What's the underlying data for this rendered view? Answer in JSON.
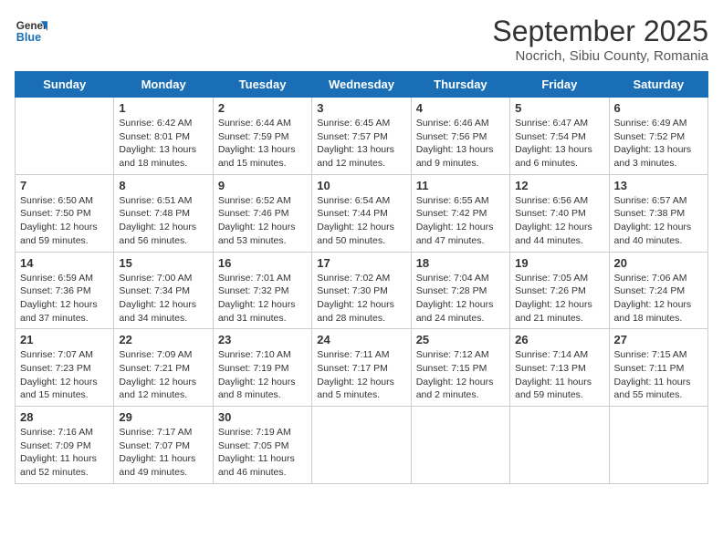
{
  "logo": {
    "line1": "General",
    "line2": "Blue"
  },
  "title": "September 2025",
  "subtitle": "Nocrich, Sibiu County, Romania",
  "days_of_week": [
    "Sunday",
    "Monday",
    "Tuesday",
    "Wednesday",
    "Thursday",
    "Friday",
    "Saturday"
  ],
  "weeks": [
    [
      {
        "day": "",
        "info": ""
      },
      {
        "day": "1",
        "info": "Sunrise: 6:42 AM\nSunset: 8:01 PM\nDaylight: 13 hours\nand 18 minutes."
      },
      {
        "day": "2",
        "info": "Sunrise: 6:44 AM\nSunset: 7:59 PM\nDaylight: 13 hours\nand 15 minutes."
      },
      {
        "day": "3",
        "info": "Sunrise: 6:45 AM\nSunset: 7:57 PM\nDaylight: 13 hours\nand 12 minutes."
      },
      {
        "day": "4",
        "info": "Sunrise: 6:46 AM\nSunset: 7:56 PM\nDaylight: 13 hours\nand 9 minutes."
      },
      {
        "day": "5",
        "info": "Sunrise: 6:47 AM\nSunset: 7:54 PM\nDaylight: 13 hours\nand 6 minutes."
      },
      {
        "day": "6",
        "info": "Sunrise: 6:49 AM\nSunset: 7:52 PM\nDaylight: 13 hours\nand 3 minutes."
      }
    ],
    [
      {
        "day": "7",
        "info": "Sunrise: 6:50 AM\nSunset: 7:50 PM\nDaylight: 12 hours\nand 59 minutes."
      },
      {
        "day": "8",
        "info": "Sunrise: 6:51 AM\nSunset: 7:48 PM\nDaylight: 12 hours\nand 56 minutes."
      },
      {
        "day": "9",
        "info": "Sunrise: 6:52 AM\nSunset: 7:46 PM\nDaylight: 12 hours\nand 53 minutes."
      },
      {
        "day": "10",
        "info": "Sunrise: 6:54 AM\nSunset: 7:44 PM\nDaylight: 12 hours\nand 50 minutes."
      },
      {
        "day": "11",
        "info": "Sunrise: 6:55 AM\nSunset: 7:42 PM\nDaylight: 12 hours\nand 47 minutes."
      },
      {
        "day": "12",
        "info": "Sunrise: 6:56 AM\nSunset: 7:40 PM\nDaylight: 12 hours\nand 44 minutes."
      },
      {
        "day": "13",
        "info": "Sunrise: 6:57 AM\nSunset: 7:38 PM\nDaylight: 12 hours\nand 40 minutes."
      }
    ],
    [
      {
        "day": "14",
        "info": "Sunrise: 6:59 AM\nSunset: 7:36 PM\nDaylight: 12 hours\nand 37 minutes."
      },
      {
        "day": "15",
        "info": "Sunrise: 7:00 AM\nSunset: 7:34 PM\nDaylight: 12 hours\nand 34 minutes."
      },
      {
        "day": "16",
        "info": "Sunrise: 7:01 AM\nSunset: 7:32 PM\nDaylight: 12 hours\nand 31 minutes."
      },
      {
        "day": "17",
        "info": "Sunrise: 7:02 AM\nSunset: 7:30 PM\nDaylight: 12 hours\nand 28 minutes."
      },
      {
        "day": "18",
        "info": "Sunrise: 7:04 AM\nSunset: 7:28 PM\nDaylight: 12 hours\nand 24 minutes."
      },
      {
        "day": "19",
        "info": "Sunrise: 7:05 AM\nSunset: 7:26 PM\nDaylight: 12 hours\nand 21 minutes."
      },
      {
        "day": "20",
        "info": "Sunrise: 7:06 AM\nSunset: 7:24 PM\nDaylight: 12 hours\nand 18 minutes."
      }
    ],
    [
      {
        "day": "21",
        "info": "Sunrise: 7:07 AM\nSunset: 7:23 PM\nDaylight: 12 hours\nand 15 minutes."
      },
      {
        "day": "22",
        "info": "Sunrise: 7:09 AM\nSunset: 7:21 PM\nDaylight: 12 hours\nand 12 minutes."
      },
      {
        "day": "23",
        "info": "Sunrise: 7:10 AM\nSunset: 7:19 PM\nDaylight: 12 hours\nand 8 minutes."
      },
      {
        "day": "24",
        "info": "Sunrise: 7:11 AM\nSunset: 7:17 PM\nDaylight: 12 hours\nand 5 minutes."
      },
      {
        "day": "25",
        "info": "Sunrise: 7:12 AM\nSunset: 7:15 PM\nDaylight: 12 hours\nand 2 minutes."
      },
      {
        "day": "26",
        "info": "Sunrise: 7:14 AM\nSunset: 7:13 PM\nDaylight: 11 hours\nand 59 minutes."
      },
      {
        "day": "27",
        "info": "Sunrise: 7:15 AM\nSunset: 7:11 PM\nDaylight: 11 hours\nand 55 minutes."
      }
    ],
    [
      {
        "day": "28",
        "info": "Sunrise: 7:16 AM\nSunset: 7:09 PM\nDaylight: 11 hours\nand 52 minutes."
      },
      {
        "day": "29",
        "info": "Sunrise: 7:17 AM\nSunset: 7:07 PM\nDaylight: 11 hours\nand 49 minutes."
      },
      {
        "day": "30",
        "info": "Sunrise: 7:19 AM\nSunset: 7:05 PM\nDaylight: 11 hours\nand 46 minutes."
      },
      {
        "day": "",
        "info": ""
      },
      {
        "day": "",
        "info": ""
      },
      {
        "day": "",
        "info": ""
      },
      {
        "day": "",
        "info": ""
      }
    ]
  ]
}
